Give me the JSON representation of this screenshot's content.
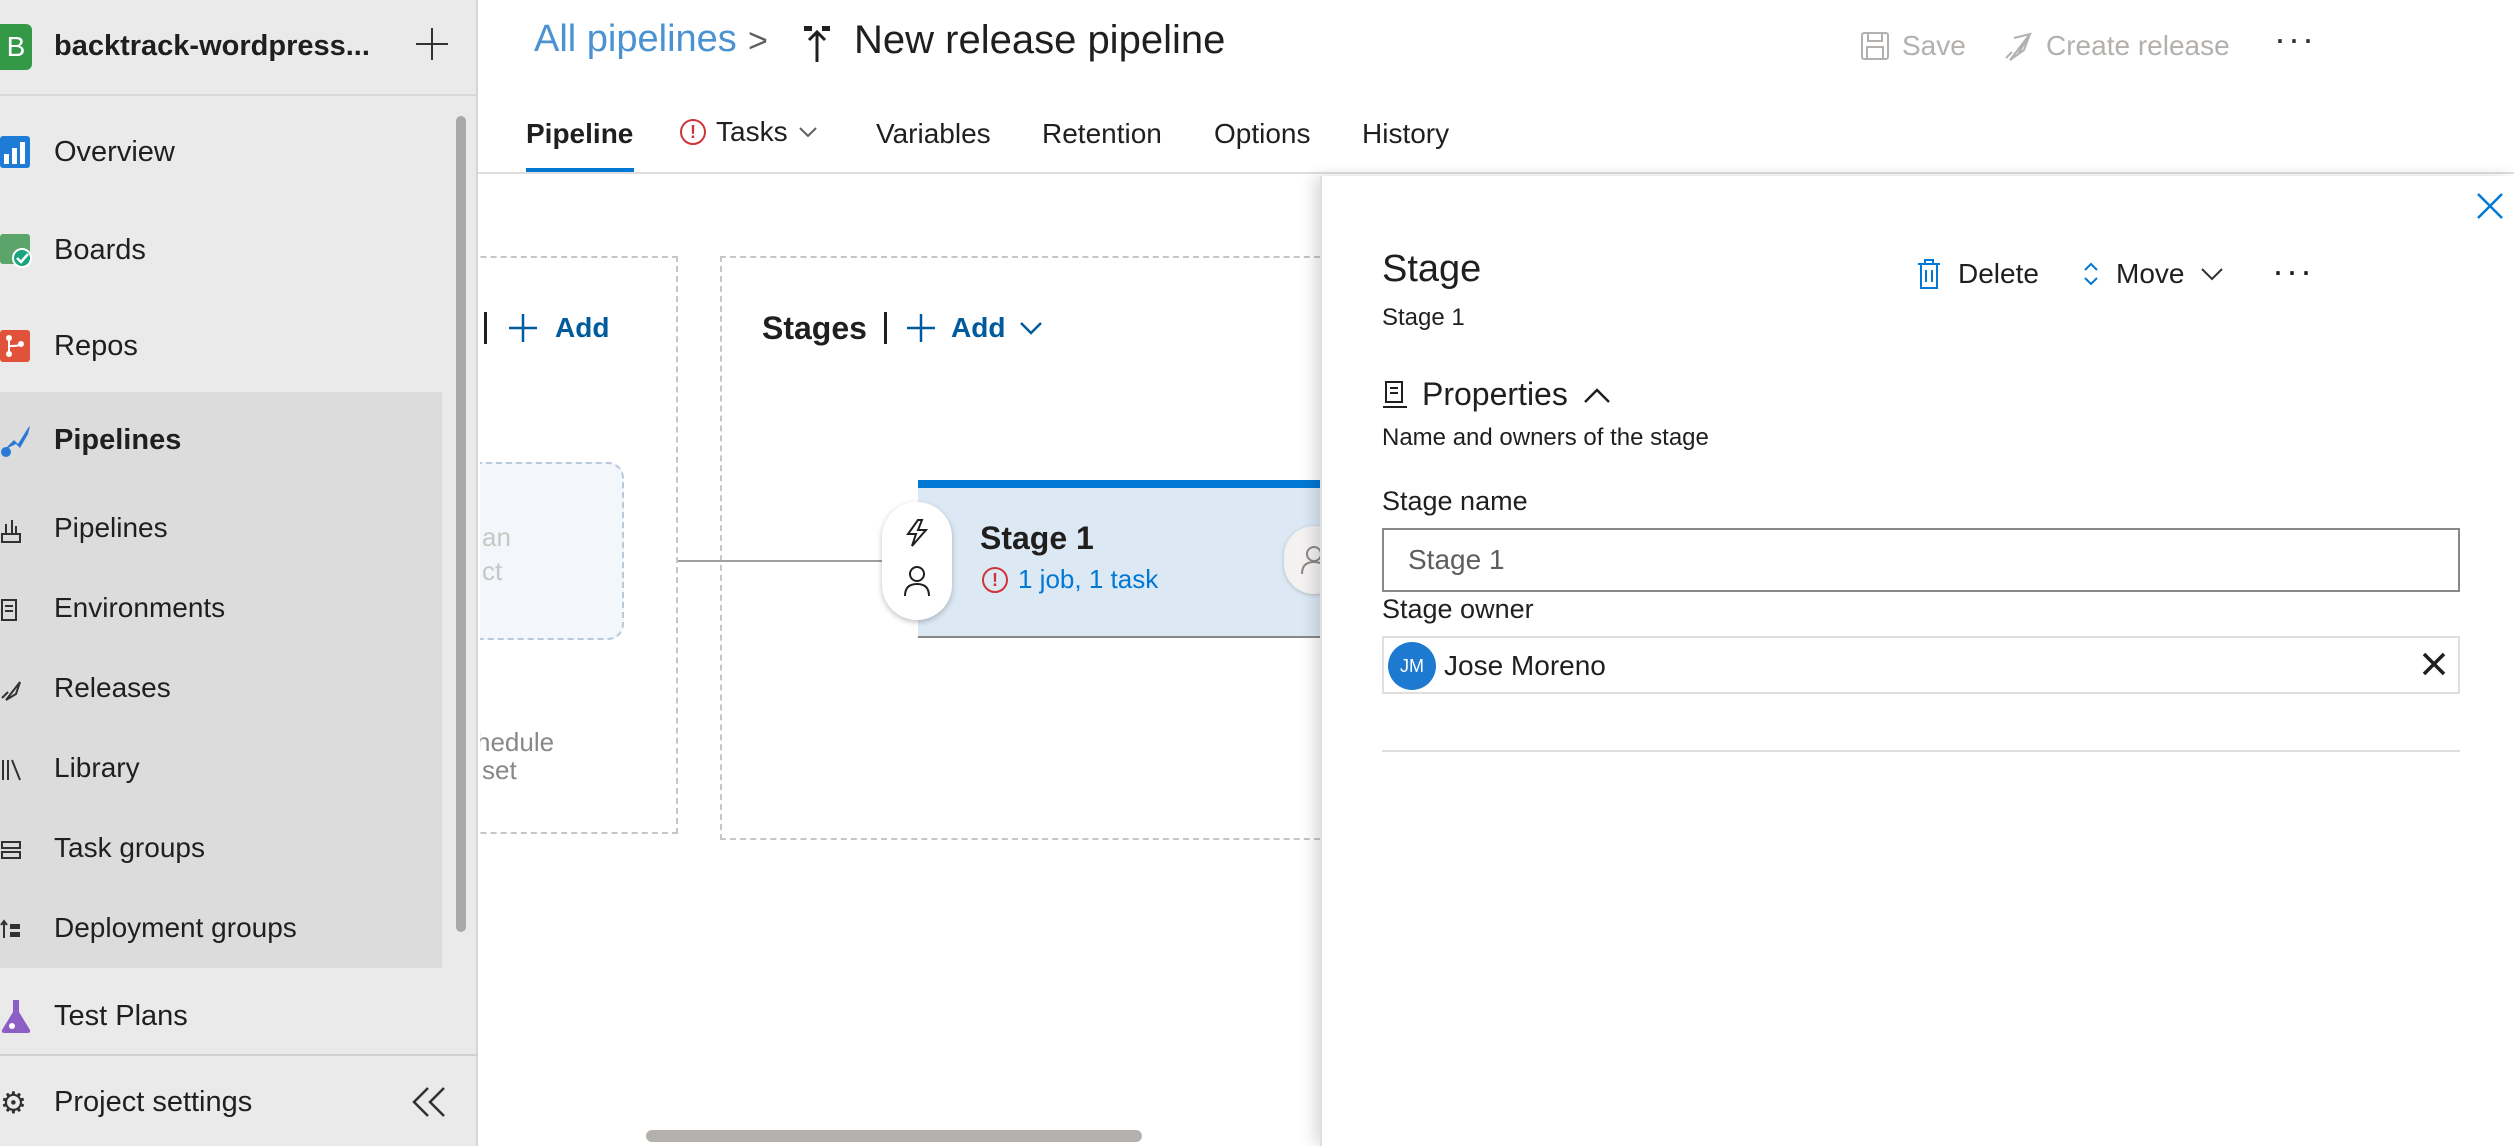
{
  "sidebar": {
    "project_initial": "B",
    "project_name": "backtrack-wordpress...",
    "items": [
      {
        "label": "Overview",
        "icon": "overview-icon"
      },
      {
        "label": "Boards",
        "icon": "boards-icon"
      },
      {
        "label": "Repos",
        "icon": "repos-icon"
      },
      {
        "label": "Pipelines",
        "icon": "pipelines-icon"
      }
    ],
    "pipelines_sub": [
      {
        "label": "Pipelines",
        "icon": "pipelines-sub-icon"
      },
      {
        "label": "Environments",
        "icon": "environments-icon"
      },
      {
        "label": "Releases",
        "icon": "releases-icon"
      },
      {
        "label": "Library",
        "icon": "library-icon"
      },
      {
        "label": "Task groups",
        "icon": "task-groups-icon"
      },
      {
        "label": "Deployment groups",
        "icon": "deployment-groups-icon"
      }
    ],
    "test_plans": "Test Plans",
    "project_settings": "Project settings"
  },
  "header": {
    "breadcrumb_all": "All pipelines",
    "breadcrumb_sep": ">",
    "title": "New release pipeline",
    "save": "Save",
    "create_release": "Create release",
    "more": "···"
  },
  "tabs": [
    "Pipeline",
    "Tasks",
    "Variables",
    "Retention",
    "Options",
    "History"
  ],
  "canvas": {
    "add_artifacts": "Add",
    "stages_label": "Stages",
    "add_stage": "Add",
    "artifact_hint_1": "an",
    "artifact_hint_2": "ct",
    "schedule_1": "hedule",
    "schedule_2": "set",
    "stage": {
      "title": "Stage 1",
      "summary": "1 job, 1 task"
    }
  },
  "panel": {
    "title": "Stage",
    "subtitle": "Stage 1",
    "delete": "Delete",
    "move": "Move",
    "more": "···",
    "section_title": "Properties",
    "section_desc": "Name and owners of the stage",
    "stage_name_label": "Stage name",
    "stage_name_value": "Stage 1",
    "stage_owner_label": "Stage owner",
    "owner_initials": "JM",
    "owner_name": "Jose Moreno"
  },
  "colors": {
    "accent": "#0078d4",
    "link": "#4b92d2",
    "error": "#d13438",
    "project_badge": "#339947"
  }
}
